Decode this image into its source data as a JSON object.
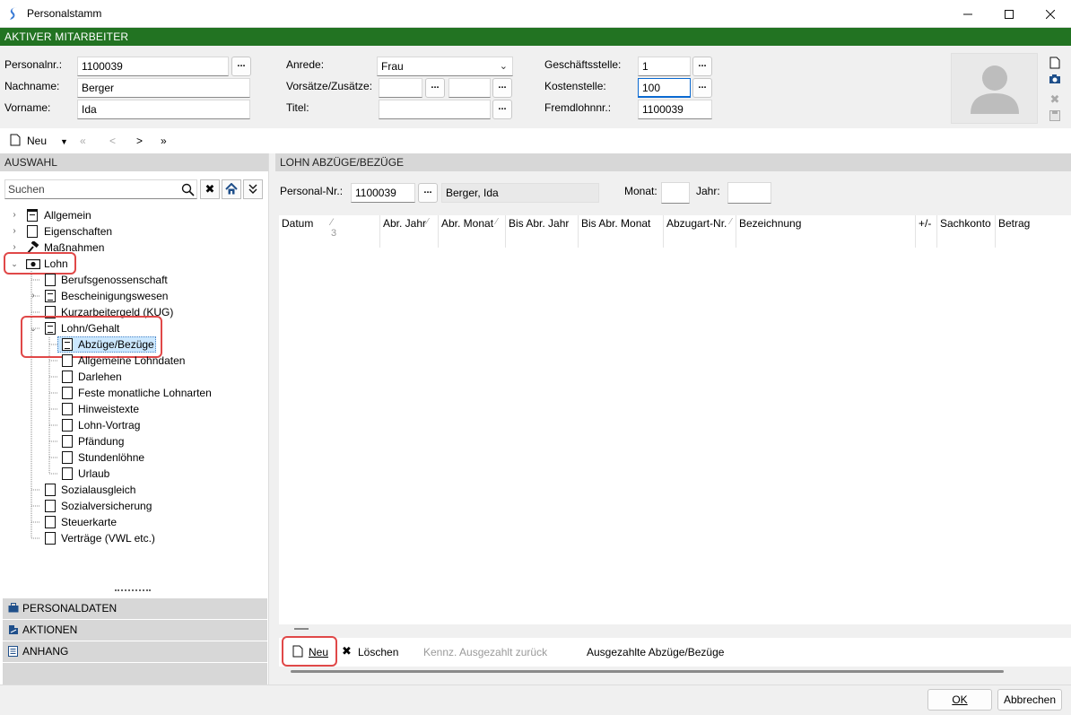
{
  "window": {
    "title": "Personalstamm"
  },
  "active_bar": {
    "label": "AKTIVER MITARBEITER"
  },
  "header": {
    "personalnr_label": "Personalnr.:",
    "personalnr_value": "1100039",
    "nachname_label": "Nachname:",
    "nachname_value": "Berger",
    "vorname_label": "Vorname:",
    "vorname_value": "Ida",
    "anrede_label": "Anrede:",
    "anrede_value": "Frau",
    "vorsaetze_label": "Vorsätze/Zusätze:",
    "vorsaetze_value1": "",
    "vorsaetze_value2": "",
    "titel_label": "Titel:",
    "titel_value": "",
    "geschaeftsstelle_label": "Geschäftsstelle:",
    "geschaeftsstelle_value": "1",
    "kostenstelle_label": "Kostenstelle:",
    "kostenstelle_value": "100",
    "fremdlohnnr_label": "Fremdlohnnr.:",
    "fremdlohnnr_value": "1100039",
    "dots": "..."
  },
  "nav": {
    "neu_label": "Neu",
    "first": "«",
    "prev": "<",
    "next": ">",
    "last": "»"
  },
  "left": {
    "section_title": "AUSWAHL",
    "search_placeholder": "Suchen",
    "tree": [
      {
        "label": "Allgemein"
      },
      {
        "label": "Eigenschaften"
      },
      {
        "label": "Maßnahmen"
      },
      {
        "label": "Lohn"
      },
      {
        "label": "Berufsgenossenschaft"
      },
      {
        "label": "Bescheinigungswesen"
      },
      {
        "label": "Kurzarbeitergeld (KUG)"
      },
      {
        "label": "Lohn/Gehalt"
      },
      {
        "label": "Abzüge/Bezüge"
      },
      {
        "label": "Allgemeine Lohndaten"
      },
      {
        "label": "Darlehen"
      },
      {
        "label": "Feste monatliche Lohnarten"
      },
      {
        "label": "Hinweistexte"
      },
      {
        "label": "Lohn-Vortrag"
      },
      {
        "label": "Pfändung"
      },
      {
        "label": "Stundenlöhne"
      },
      {
        "label": "Urlaub"
      },
      {
        "label": "Sozialausgleich"
      },
      {
        "label": "Sozialversicherung"
      },
      {
        "label": "Steuerkarte"
      },
      {
        "label": "Verträge (VWL etc.)"
      }
    ],
    "accordion": [
      {
        "label": "PERSONALDATEN"
      },
      {
        "label": "AKTIONEN"
      },
      {
        "label": "ANHANG"
      }
    ]
  },
  "right": {
    "section_title": "LOHN ABZÜGE/BEZÜGE",
    "personal_nr_label": "Personal-Nr.:",
    "personal_nr_value": "1100039",
    "name_value": "Berger, Ida",
    "monat_label": "Monat:",
    "monat_value": "",
    "jahr_label": "Jahr:",
    "jahr_value": "",
    "columns": [
      "Datum",
      "Abr. Jahr",
      "Abr. Monat",
      "Bis Abr. Jahr",
      "Bis Abr. Monat",
      "Abzugart-Nr.",
      "Bezeichnung",
      "+/-",
      "Sachkonto",
      "Betrag"
    ],
    "sort_indicator": "3",
    "actions": {
      "neu": "Neu",
      "loeschen": "Löschen",
      "kennz": "Kennz. Ausgezahlt zurück",
      "ausgezahlte": "Ausgezahlte Abzüge/Bezüge"
    }
  },
  "footer": {
    "ok": "OK",
    "abbrechen": "Abbrechen"
  },
  "colors": {
    "accent_green": "#227322",
    "highlight_red": "#e04848",
    "selection_blue": "#cce8ff"
  }
}
